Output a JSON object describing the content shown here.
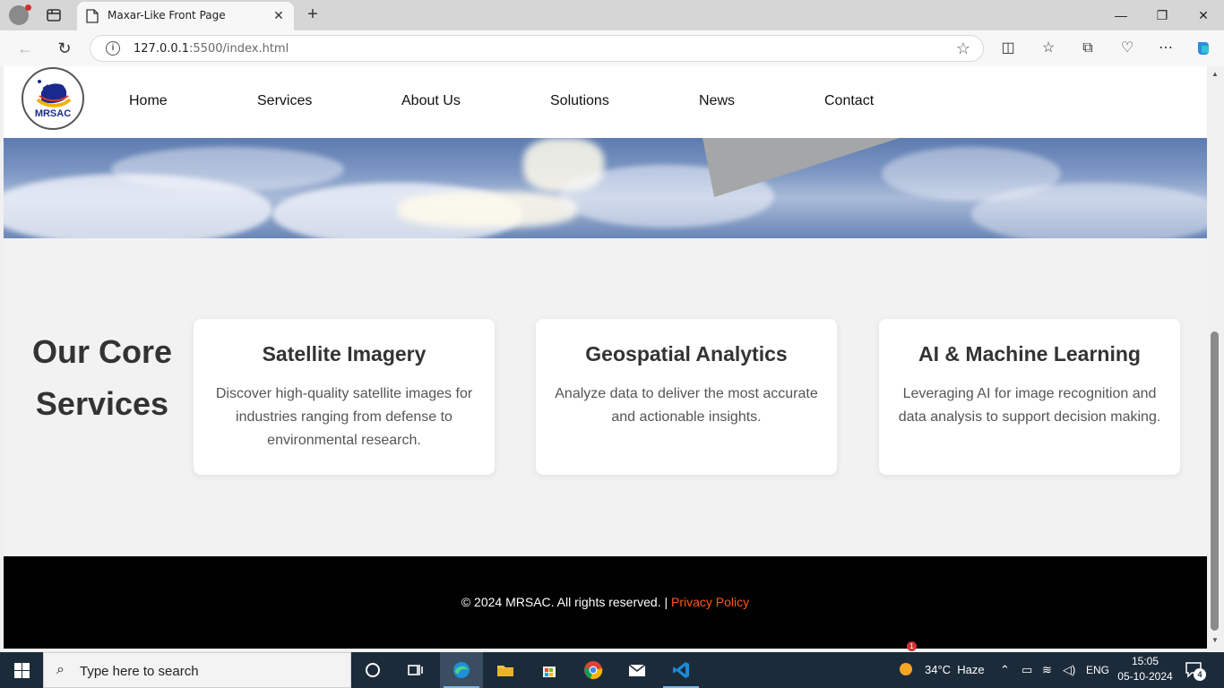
{
  "browser": {
    "tab_title": "Maxar-Like Front Page",
    "url_host": "127.0.0.1",
    "url_path": ":5500/index.html"
  },
  "site": {
    "logo_text": "MRSAC",
    "nav": [
      "Home",
      "Services",
      "About Us",
      "Solutions",
      "News",
      "Contact"
    ],
    "services_title_line1": "Our Core",
    "services_title_line2": "Services",
    "cards": [
      {
        "title": "Satellite Imagery",
        "text": "Discover high-quality satellite images for industries ranging from defense to environmental research."
      },
      {
        "title": "Geospatial Analytics",
        "text": "Analyze data to deliver the most accurate and actionable insights."
      },
      {
        "title": "AI & Machine Learning",
        "text": "Leveraging AI for image recognition and data analysis to support decision making."
      }
    ],
    "footer_text": "© 2024 MRSAC. All rights reserved. | ",
    "footer_link": "Privacy Policy",
    "accent_color": "#ff5722"
  },
  "taskbar": {
    "search_placeholder": "Type here to search",
    "weather": "34°C  Haze",
    "weather_badge": "1",
    "language": "ENG",
    "time": "15:05",
    "date": "05-10-2024",
    "notification_count": "4"
  }
}
